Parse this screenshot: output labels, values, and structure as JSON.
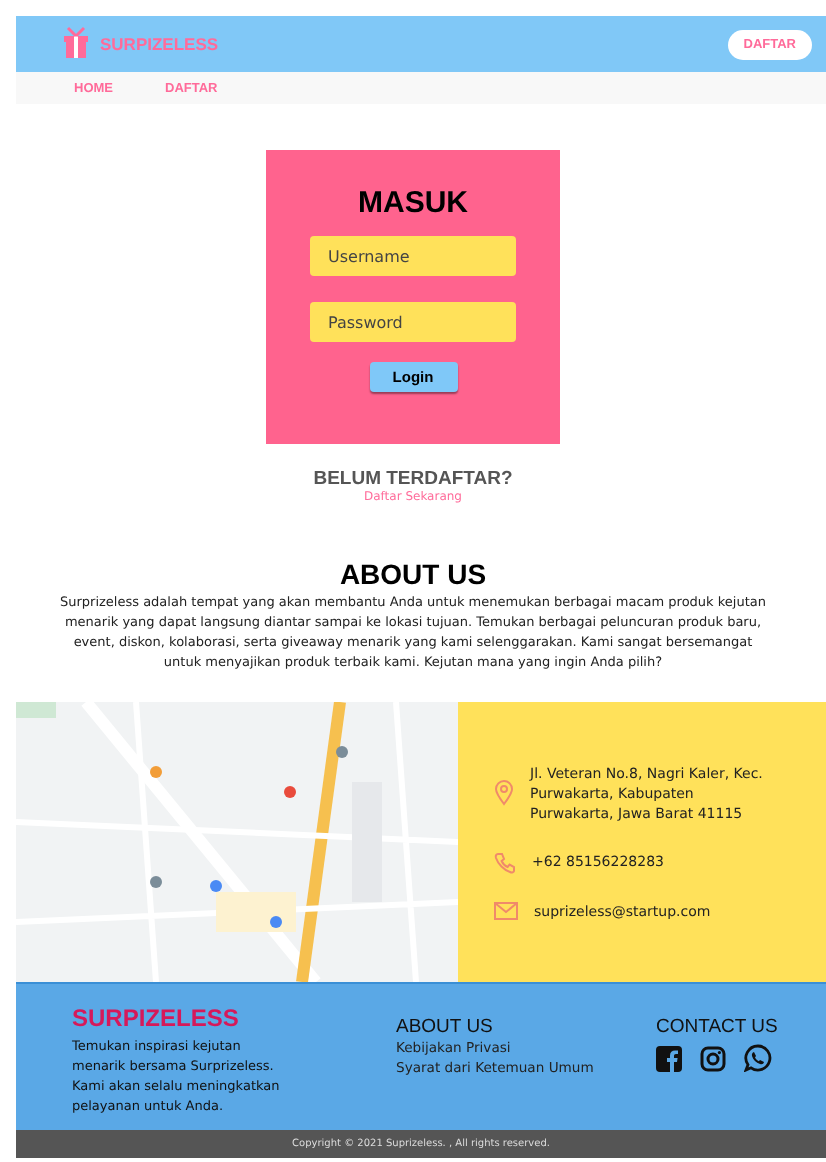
{
  "header": {
    "brand": "SURPIZELESS",
    "button": "DAFTAR"
  },
  "nav": [
    {
      "label": "HOME"
    },
    {
      "label": "DAFTAR"
    }
  ],
  "login": {
    "title": "MASUK",
    "fields": [
      {
        "placeholder": "Username"
      },
      {
        "placeholder": "Password"
      }
    ],
    "button": "Login"
  },
  "register": {
    "question": "BELUM TERDAFTAR?",
    "link": "Daftar Sekarang"
  },
  "about": {
    "title": "ABOUT US",
    "text": "Surprizeless adalah tempat yang akan membantu Anda untuk menemukan berbagai macam produk kejutan menarik yang dapat langsung diantar sampai ke lokasi tujuan. Temukan berbagai peluncuran produk baru, event, diskon, kolaborasi, serta giveaway menarik yang kami selenggarakan. Kami sangat bersemangat untuk menyajikan produk terbaik kami. Kejutan mana yang ingin Anda pilih?"
  },
  "contact": [
    {
      "kind": "address",
      "text": "Jl. Veteran No.8, Nagri Kaler, Kec. Purwakarta, Kabupaten Purwakarta, Jawa Barat 41115"
    },
    {
      "kind": "phone",
      "text": "+62 85156228283"
    },
    {
      "kind": "email",
      "text": "suprizeless@startup.com"
    }
  ],
  "footer": {
    "brand": "SURPIZELESS",
    "description": "Temukan inspirasi kejutan menarik bersama Surprizeless. Kami akan selalu meningkatkan pelayanan untuk Anda.",
    "about_title": "ABOUT US",
    "links": [
      "Kebijakan Privasi",
      "Syarat dari Ketemuan Umum"
    ],
    "contact_title": "CONTACT US",
    "social": [
      {
        "kind": "facebook"
      },
      {
        "kind": "instagram"
      },
      {
        "kind": "whatsapp"
      }
    ]
  },
  "copyright": "Copyright © 2021 Suprizeless. , All rights reserved."
}
